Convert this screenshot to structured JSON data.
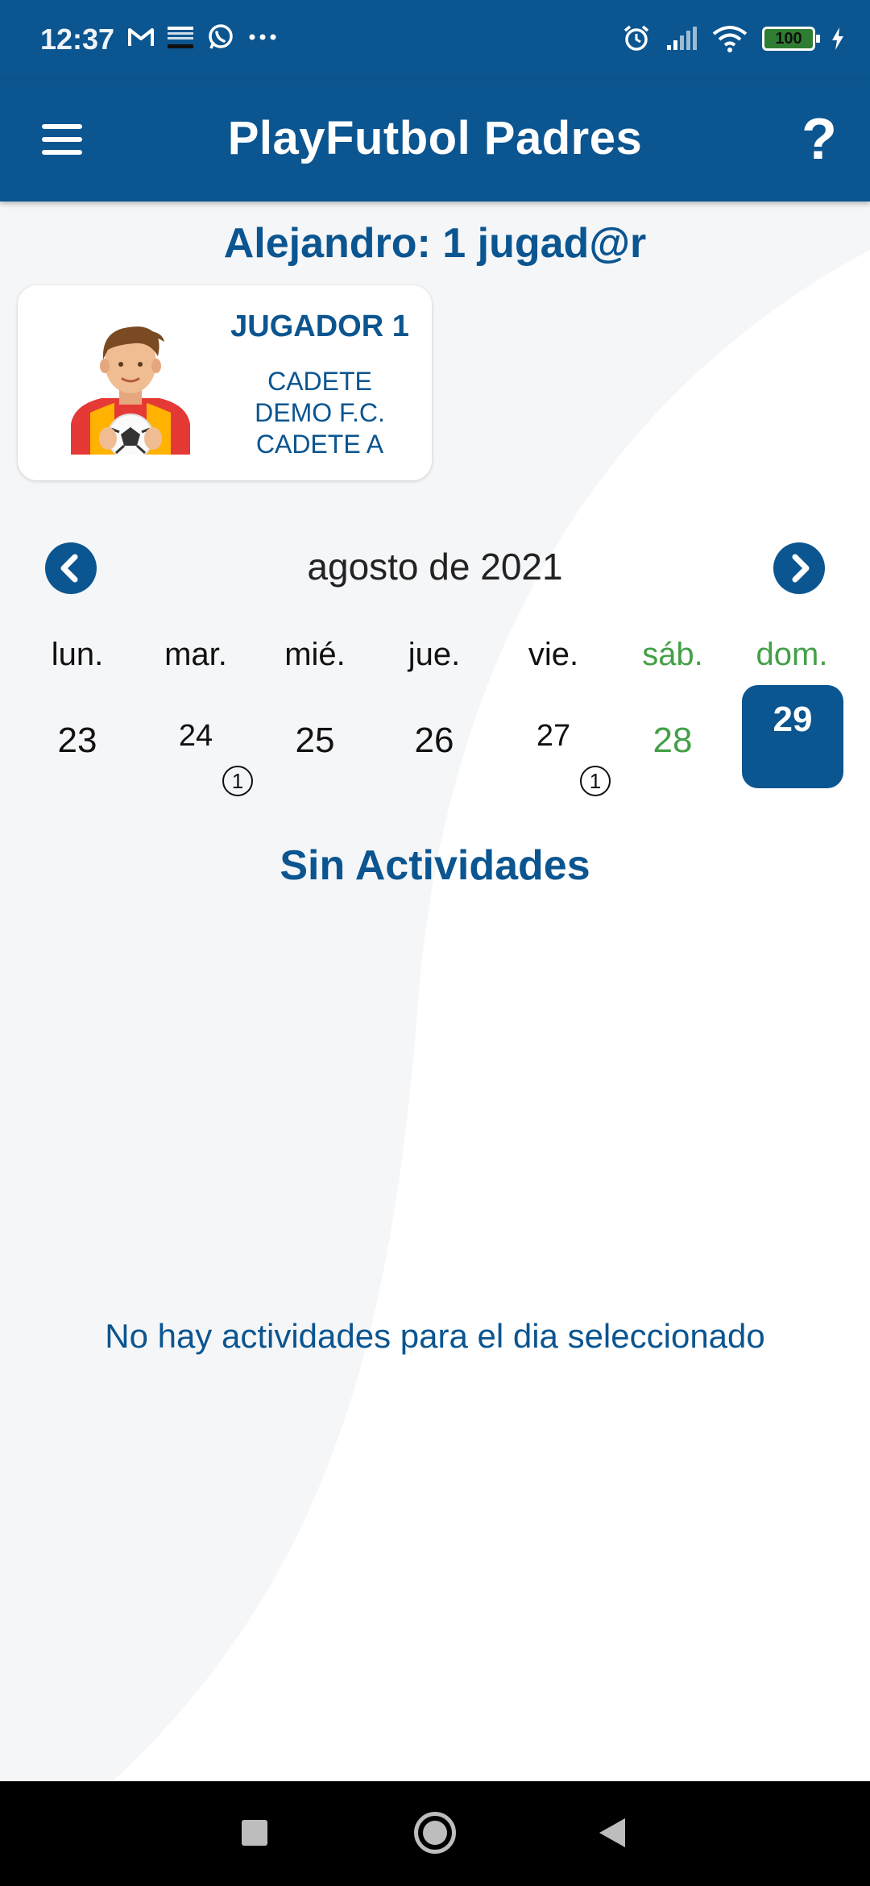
{
  "status_bar": {
    "time": "12:37",
    "battery": "100",
    "icons_left": [
      "gmail-icon",
      "news-icon",
      "whatsapp-icon",
      "more-icon"
    ],
    "icons_right": [
      "alarm-icon",
      "signal-icon",
      "wifi-icon",
      "battery-icon",
      "charging-icon"
    ]
  },
  "app_bar": {
    "title": "PlayFutbol Padres",
    "help_label": "?"
  },
  "user_heading": "Alejandro: 1 jugad@r",
  "player": {
    "name": "JUGADOR 1",
    "category": "CADETE",
    "club": "DEMO F.C.",
    "team": "CADETE A"
  },
  "calendar": {
    "month_label": "agosto de 2021",
    "weekdays": [
      "lun.",
      "mar.",
      "mié.",
      "jue.",
      "vie.",
      "sáb.",
      "dom."
    ],
    "days": [
      {
        "day": "23",
        "badge": null
      },
      {
        "day": "24",
        "badge": "1"
      },
      {
        "day": "25",
        "badge": null
      },
      {
        "day": "26",
        "badge": null
      },
      {
        "day": "27",
        "badge": "1"
      },
      {
        "day": "28",
        "badge": null
      },
      {
        "day": "29",
        "badge": null,
        "selected": true
      }
    ]
  },
  "activities": {
    "title": "Sin Actividades",
    "empty_message": "No hay actividades para el dia seleccionado"
  },
  "colors": {
    "primary": "#0b5590",
    "weekend": "#43a047",
    "background": "#f5f6f8"
  }
}
